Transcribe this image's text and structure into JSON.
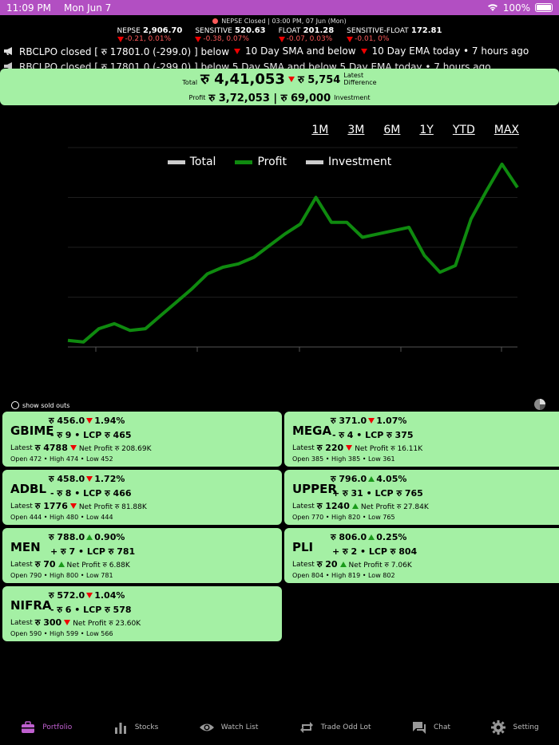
{
  "status_bar": {
    "time": "11:09 PM",
    "date": "Mon Jun 7",
    "battery": "100%"
  },
  "market": {
    "status": "NEPSE Closed | 03:00 PM, 07 Jun (Mon)",
    "indices": [
      {
        "name": "NEPSE",
        "value": "2,906.70",
        "change": "-0.21, 0.01%"
      },
      {
        "name": "SENSITIVE",
        "value": "520.63",
        "change": "-0.38, 0.07%"
      },
      {
        "name": "FLOAT",
        "value": "201.28",
        "change": "-0.07, 0.03%"
      },
      {
        "name": "SENSITIVE-FLOAT",
        "value": "172.81",
        "change": "-0.01, 0%"
      }
    ]
  },
  "ticker": {
    "line1_a": "RBCLPO closed  [ रु 17801.0 (-299.0) ] below",
    "line1_b": "10 Day SMA and below",
    "line1_c": "10 Day EMA today • 7 hours ago",
    "line2": "RBCLPO closed  [ रु 17801.0 (-299.0) ] below  5 Day SMA and below  5 Day EMA today • 7 hours ago"
  },
  "summary": {
    "total_label": "Total",
    "total": "रु 4,41,053",
    "latest_diff": "रु 5,754",
    "latest_label1": "Latest",
    "latest_label2": "Difference",
    "profit_label": "Profit",
    "profit_investment": "रु 3,72,053 | रु 69,000",
    "investment_label": "Investment"
  },
  "ranges": [
    "1M",
    "3M",
    "6M",
    "1Y",
    "YTD",
    "MAX"
  ],
  "legend": [
    {
      "label": "Total",
      "color": "#cccccc"
    },
    {
      "label": "Profit",
      "color": "#0f8a0f"
    },
    {
      "label": "Investment",
      "color": "#cccccc"
    }
  ],
  "chart_data": {
    "type": "line",
    "series": [
      {
        "name": "Profit",
        "color": "#0f8a0f",
        "values": [
          0.04,
          0.03,
          0.11,
          0.14,
          0.1,
          0.11,
          0.19,
          0.27,
          0.35,
          0.44,
          0.48,
          0.5,
          0.54,
          0.61,
          0.68,
          0.74,
          0.9,
          0.75,
          0.75,
          0.66,
          0.68,
          0.7,
          0.72,
          0.55,
          0.45,
          0.49,
          0.77,
          0.94,
          1.1,
          0.96
        ]
      }
    ],
    "ylim": [
      0,
      1.2
    ],
    "grid": true
  },
  "sold_toggle": "show sold outs",
  "cards": [
    {
      "symbol": "GBIME",
      "price": "रु 456.0",
      "pct": "1.94%",
      "dir": "down",
      "chg": "- रु 9",
      "lcp": "LCP रु 465",
      "latest": "रु 4788",
      "latest_dir": "down",
      "net": "Net Profit रु 208.69K",
      "ohl": "Open 472 • High 474 • Low 452"
    },
    {
      "symbol": "MEGA",
      "price": "रु 371.0",
      "pct": "1.07%",
      "dir": "down",
      "chg": "- रु 4",
      "lcp": "LCP रु 375",
      "latest": "रु 220",
      "latest_dir": "down",
      "net": "Net Profit रु 16.11K",
      "ohl": "Open 385 • High 385 • Low 361"
    },
    {
      "symbol": "ADBL",
      "price": "रु 458.0",
      "pct": "1.72%",
      "dir": "down",
      "chg": "- रु 8",
      "lcp": "LCP रु 466",
      "latest": "रु 1776",
      "latest_dir": "down",
      "net": "Net Profit रु 81.88K",
      "ohl": "Open 444 • High 480 • Low 444"
    },
    {
      "symbol": "UPPER",
      "price": "रु 796.0",
      "pct": "4.05%",
      "dir": "up",
      "chg": "+ रु 31",
      "lcp": "LCP रु 765",
      "latest": "रु 1240",
      "latest_dir": "up",
      "net": "Net Profit रु 27.84K",
      "ohl": "Open 770 • High 820 • Low 765"
    },
    {
      "symbol": "MEN",
      "price": "रु 788.0",
      "pct": "0.90%",
      "dir": "up",
      "chg": "+ रु 7",
      "lcp": "LCP रु 781",
      "latest": "रु 70",
      "latest_dir": "up",
      "net": "Net Profit रु 6.88K",
      "ohl": "Open 790 • High 800 • Low 781"
    },
    {
      "symbol": "PLI",
      "price": "रु 806.0",
      "pct": "0.25%",
      "dir": "up",
      "chg": "+ रु 2",
      "lcp": "LCP रु 804",
      "latest": "रु 20",
      "latest_dir": "up",
      "net": "Net Profit रु 7.06K",
      "ohl": "Open 804 • High 819 • Low 802"
    },
    {
      "symbol": "NIFRA",
      "price": "रु 572.0",
      "pct": "1.04%",
      "dir": "down",
      "chg": "- रु 6",
      "lcp": "LCP रु 578",
      "latest": "रु 300",
      "latest_dir": "down",
      "net": "Net Profit रु 23.60K",
      "ohl": "Open 590 • High 599 • Low 566"
    }
  ],
  "tabs": [
    {
      "label": "Portfolio",
      "icon": "briefcase-icon",
      "active": true
    },
    {
      "label": "Stocks",
      "icon": "bar-chart-icon",
      "active": false
    },
    {
      "label": "Watch List",
      "icon": "eye-icon",
      "active": false
    },
    {
      "label": "Trade Odd Lot",
      "icon": "repeat-icon",
      "active": false
    },
    {
      "label": "Chat",
      "icon": "chat-icon",
      "active": false
    },
    {
      "label": "Setting",
      "icon": "gear-icon",
      "active": false
    }
  ],
  "colors": {
    "accent": "#b24fc2",
    "card_bg": "#a4f0a4",
    "down": "#e00000",
    "up": "#1a9a1a"
  }
}
